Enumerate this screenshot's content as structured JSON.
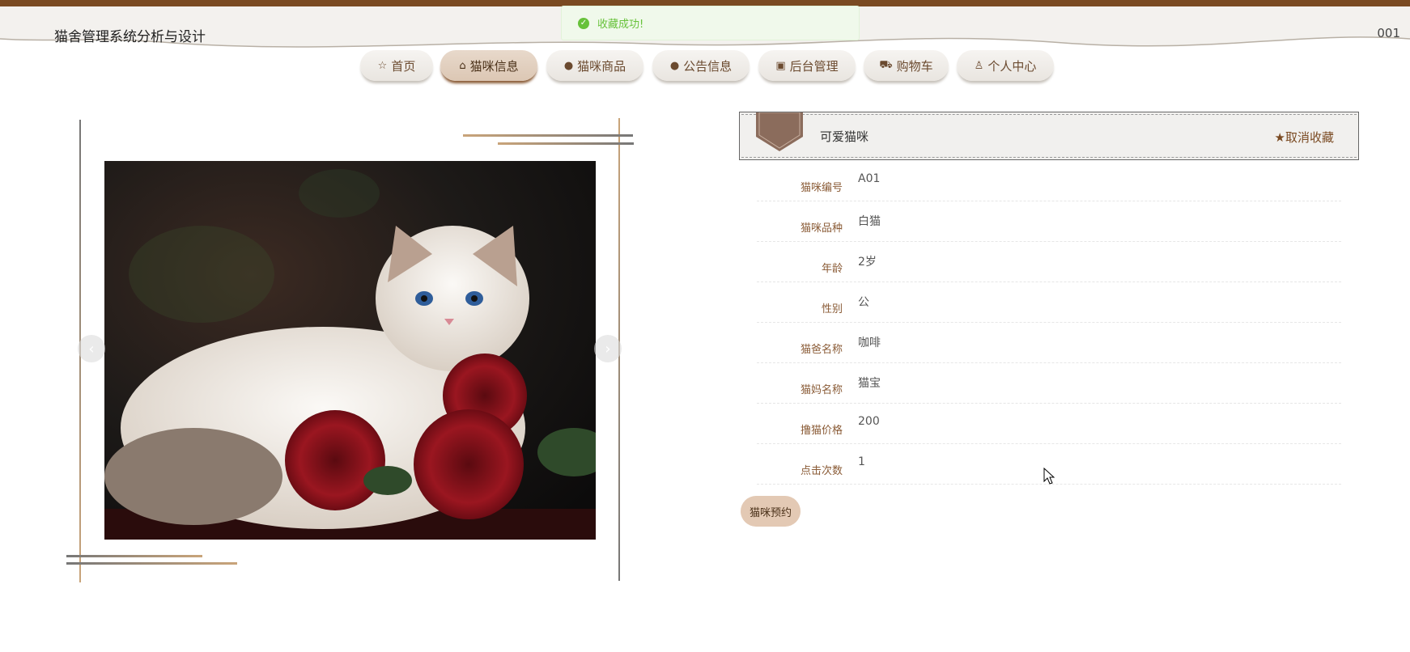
{
  "header": {
    "site_title": "猫舍管理系统分析与设计",
    "user_id": "001"
  },
  "toast": {
    "message": "收藏成功!",
    "icon": "success-check-icon",
    "color": "#67c23a"
  },
  "nav": {
    "items": [
      {
        "label": "首页",
        "icon": "star-outline-icon"
      },
      {
        "label": "猫咪信息",
        "icon": "bag-icon",
        "active": true
      },
      {
        "label": "猫咪商品",
        "icon": "info-circle-icon"
      },
      {
        "label": "公告信息",
        "icon": "help-circle-icon"
      },
      {
        "label": "后台管理",
        "icon": "box-icon"
      },
      {
        "label": "购物车",
        "icon": "cart-icon"
      },
      {
        "label": "个人中心",
        "icon": "user-icon"
      }
    ]
  },
  "detail": {
    "name": "可爱猫咪",
    "fav_label": "取消收藏",
    "fields": [
      {
        "label": "猫咪编号",
        "value": "A01"
      },
      {
        "label": "猫咪品种",
        "value": "白猫"
      },
      {
        "label": "年龄",
        "value": "2岁"
      },
      {
        "label": "性别",
        "value": "公"
      },
      {
        "label": "猫爸名称",
        "value": "咖啡"
      },
      {
        "label": "猫妈名称",
        "value": "猫宝"
      },
      {
        "label": "撸猫价格",
        "value": "200"
      },
      {
        "label": "点击次数",
        "value": "1"
      }
    ],
    "book_label": "猫咪预约"
  },
  "colors": {
    "brand": "#7a4a22",
    "accent_light": "#e3c9b4",
    "label": "#8a5b36"
  }
}
